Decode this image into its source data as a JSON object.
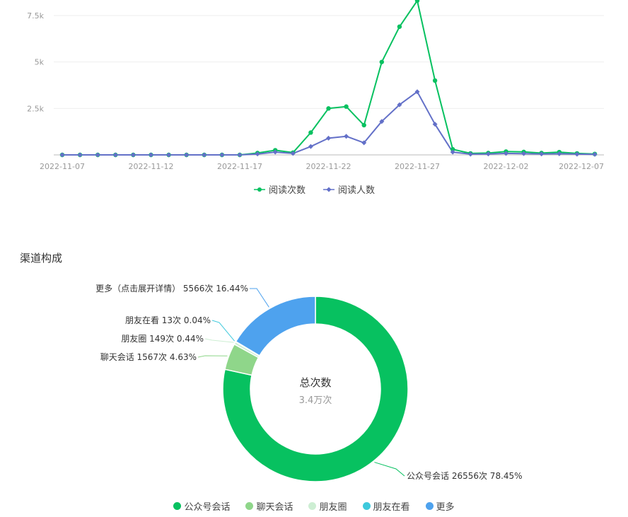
{
  "section_title": "渠道构成",
  "chart_data": [
    {
      "type": "line",
      "x": [
        "2022-11-07",
        "2022-11-08",
        "2022-11-09",
        "2022-11-10",
        "2022-11-11",
        "2022-11-12",
        "2022-11-13",
        "2022-11-14",
        "2022-11-15",
        "2022-11-16",
        "2022-11-17",
        "2022-11-18",
        "2022-11-19",
        "2022-11-20",
        "2022-11-21",
        "2022-11-22",
        "2022-11-23",
        "2022-11-24",
        "2022-11-25",
        "2022-11-26",
        "2022-11-27",
        "2022-11-28",
        "2022-11-29",
        "2022-11-30",
        "2022-12-01",
        "2022-12-02",
        "2022-12-03",
        "2022-12-04",
        "2022-12-05",
        "2022-12-06",
        "2022-12-07"
      ],
      "x_tick_labels": [
        "2022-11-07",
        "2022-11-12",
        "2022-11-17",
        "2022-11-22",
        "2022-11-27",
        "2022-12-02",
        "2022-12-07"
      ],
      "y_tick_labels": [
        "2.5k",
        "5k",
        "7.5k"
      ],
      "y_ticks": [
        2500,
        5000,
        7500
      ],
      "ylim": [
        0,
        8400
      ],
      "series": [
        {
          "name": "阅读次数",
          "color": "#07c160",
          "marker": "circle",
          "values": [
            0,
            0,
            0,
            0,
            0,
            0,
            0,
            0,
            0,
            0,
            0,
            100,
            250,
            120,
            1200,
            2500,
            2600,
            1600,
            5000,
            6900,
            8300,
            4000,
            300,
            80,
            100,
            180,
            160,
            100,
            150,
            80,
            50
          ]
        },
        {
          "name": "阅读人数",
          "color": "#6370c8",
          "marker": "diamond",
          "values": [
            0,
            0,
            0,
            0,
            0,
            0,
            0,
            0,
            0,
            0,
            0,
            50,
            150,
            80,
            450,
            900,
            1000,
            650,
            1800,
            2700,
            3400,
            1650,
            150,
            40,
            50,
            80,
            70,
            50,
            60,
            40,
            30
          ]
        }
      ]
    },
    {
      "type": "pie",
      "center_title": "总次数",
      "center_value": "3.4万次",
      "slices": [
        {
          "name": "公众号会话",
          "label": "公众号会话 26556次 78.45%",
          "value": 26556,
          "percent": 78.45,
          "color": "#07c160"
        },
        {
          "name": "聊天会话",
          "label": "聊天会话 1567次 4.63%",
          "value": 1567,
          "percent": 4.63,
          "color": "#8fd68a"
        },
        {
          "name": "朋友圈",
          "label": "朋友圈 149次 0.44%",
          "value": 149,
          "percent": 0.44,
          "color": "#cdeed3"
        },
        {
          "name": "朋友在看",
          "label": "朋友在看 13次 0.04%",
          "value": 13,
          "percent": 0.04,
          "color": "#3ec9dc"
        },
        {
          "name": "更多",
          "label": "更多（点击展开详情） 5566次 16.44%",
          "value": 5566,
          "percent": 16.44,
          "color": "#4ea2ee"
        }
      ]
    }
  ]
}
